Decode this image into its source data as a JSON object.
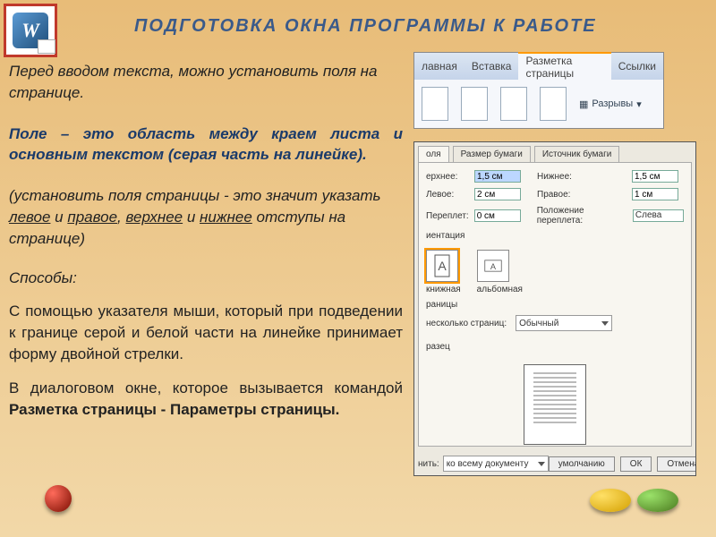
{
  "title": "ПОДГОТОВКА  ОКНА  ПРОГРАММЫ  К  РАБОТЕ",
  "word_icon_letter": "W",
  "intro": "Перед вводом текста, можно установить поля на странице.",
  "definition": "Поле – это область между краем листа и основным текстом (серая часть на линейке).",
  "explain_pre": "(установить поля  страницы -  это  значит указать  ",
  "explain_left": "левое",
  "explain_and1": "  и  ",
  "explain_right": "правое",
  "explain_comma": ",  ",
  "explain_top": "верхнее",
  "explain_and2": "  и  ",
  "explain_bottom": "нижнее",
  "explain_post": "  отступы  на  странице)",
  "ways_label": "Способы:",
  "way1": "  С помощью указателя мыши,  который при подведении  к  границе  серой  и  белой  части  на  линейке  принимает форму двойной стрелки.",
  "way2_pre": "  В диалоговом окне, которое вызывается командой  ",
  "way2_bold": "Разметка страницы - Параметры страницы.",
  "ribbon": {
    "tabs": [
      "лавная",
      "Вставка",
      "Разметка страницы",
      "Ссылки"
    ],
    "breaks": "Разрывы"
  },
  "dialog": {
    "tabs": [
      "оля",
      "Размер бумаги",
      "Источник бумаги"
    ],
    "top_l": "ерхнее:",
    "top_v": "1,5 см",
    "bot_l": "Нижнее:",
    "bot_v": "1,5 см",
    "left_l": "Левое:",
    "left_v": "2 см",
    "right_l": "Правое:",
    "right_v": "1 см",
    "gut_l": "Переплет:",
    "gut_v": "0 см",
    "gutpos_l": "Положение переплета:",
    "gutpos_v": "Слева",
    "orient_section": "иентация",
    "orient_book": "книжная",
    "orient_alb": "альбомная",
    "pages_section": "раницы",
    "pages_l": "несколько страниц:",
    "pages_v": "Обычный",
    "preview_section": "разец",
    "apply_l": "нить:",
    "apply_v": "ко всему документу",
    "default_btn": "умолчанию",
    "ok": "ОК",
    "cancel": "Отмена"
  }
}
